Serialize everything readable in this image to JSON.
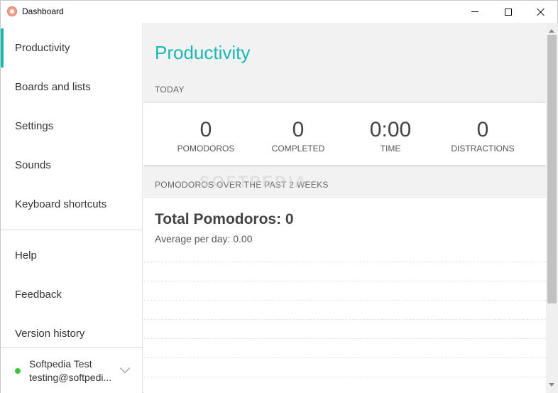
{
  "window": {
    "title": "Dashboard"
  },
  "sidebar": {
    "items": [
      {
        "label": "Productivity",
        "active": true
      },
      {
        "label": "Boards and lists"
      },
      {
        "label": "Settings"
      },
      {
        "label": "Sounds"
      },
      {
        "label": "Keyboard shortcuts"
      },
      {
        "label": "Help"
      },
      {
        "label": "Feedback"
      },
      {
        "label": "Version history"
      }
    ],
    "account": {
      "name": "Softpedia Test",
      "email": "testing@softpedi...",
      "status_color": "#3cc43c"
    }
  },
  "main": {
    "title": "Productivity",
    "today": {
      "heading": "TODAY",
      "stats": [
        {
          "value": "0",
          "label": "POMODOROS"
        },
        {
          "value": "0",
          "label": "COMPLETED"
        },
        {
          "value": "0:00",
          "label": "TIME"
        },
        {
          "value": "0",
          "label": "DISTRACTIONS"
        }
      ]
    },
    "history": {
      "heading": "POMODOROS OVER THE PAST 2 WEEKS",
      "total": "Total Pomodoros: 0",
      "average": "Average per day: 0.00"
    }
  },
  "watermark": "SOFTPEDIA",
  "colors": {
    "accent": "#1bb8b2"
  }
}
